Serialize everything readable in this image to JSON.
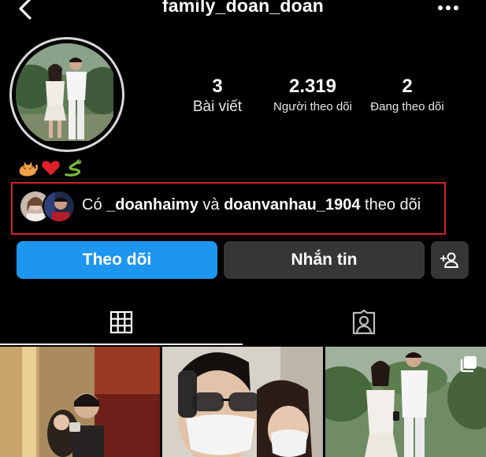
{
  "header": {
    "username": "family_doan_doan",
    "back_icon": "chevron-left-icon",
    "more_icon": "more-horizontal-icon"
  },
  "stats": {
    "posts": {
      "count": "3",
      "label": "Bài viết"
    },
    "followers": {
      "count": "2.319",
      "label": "Người theo dõi"
    },
    "following": {
      "count": "2",
      "label": "Đang theo dõi"
    }
  },
  "bio": {
    "emojis": [
      "cat",
      "red-heart",
      "snake"
    ]
  },
  "mutual": {
    "prefix": "Có ",
    "user1": "_doanhaimy",
    "middle": " và ",
    "user2": "doanvanhau_1904",
    "suffix": " theo dõi"
  },
  "actions": {
    "follow_label": "Theo dõi",
    "message_label": "Nhắn tin",
    "suggest_icon": "add-person-icon"
  },
  "tabs": [
    {
      "name": "posts-grid",
      "icon": "grid-icon",
      "active": true
    },
    {
      "name": "tagged",
      "icon": "tagged-person-icon",
      "active": false
    }
  ],
  "colors": {
    "background": "#000000",
    "follow_button": "#1c96ef",
    "secondary_button": "#363636",
    "highlight_border": "#d3202a"
  },
  "posts": [
    {
      "type": "photo"
    },
    {
      "type": "photo"
    },
    {
      "type": "carousel",
      "badge_icon": "multiple-photos-icon"
    }
  ]
}
